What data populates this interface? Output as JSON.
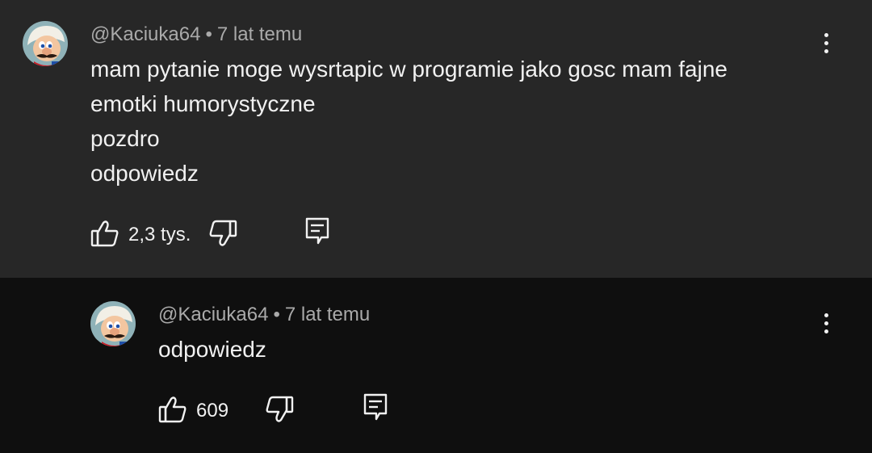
{
  "comments": [
    {
      "author": "@Kaciuka64",
      "separator": "•",
      "time": "7 lat temu",
      "lines": [
        "mam pytanie moge wysrtapic w programie jako gosc mam fajne",
        "emotki humorystyczne",
        "pozdro",
        "odpowiedz"
      ],
      "likes": "2,3 tys.",
      "background": "#272727"
    },
    {
      "author": "@Kaciuka64",
      "separator": "•",
      "time": "7 lat temu",
      "lines": [
        "odpowiedz"
      ],
      "likes": "609",
      "background": "#0f0f0f"
    }
  ],
  "icons": {
    "like": "thumb-up-icon",
    "dislike": "thumb-down-icon",
    "reply": "comment-reply-icon",
    "menu": "more-vertical-icon",
    "avatar": "mario-avatar"
  },
  "colors": {
    "text_primary": "#f1f1f1",
    "text_secondary": "#aaaaaa"
  }
}
